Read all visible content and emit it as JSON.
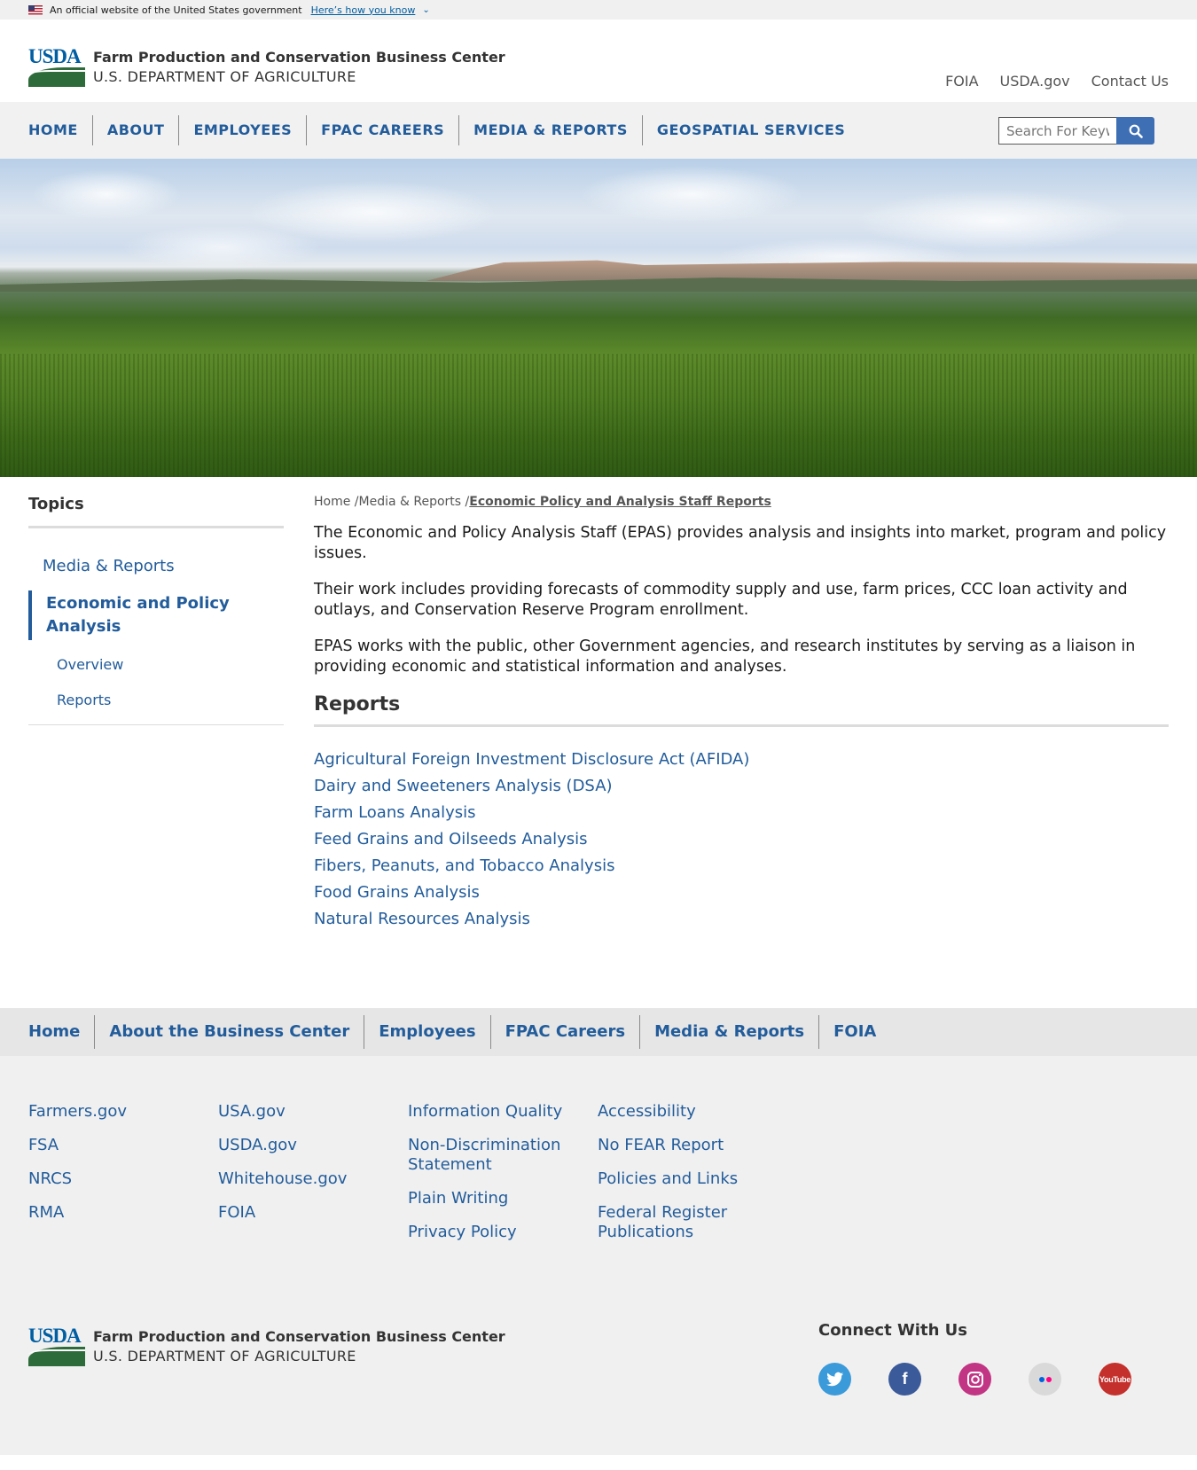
{
  "gov_banner": {
    "text": "An official website of the United States government",
    "link": "Here’s how you know"
  },
  "header": {
    "logo_text": "USDA",
    "agency_name": "Farm Production and Conservation Business Center",
    "department": "U.S. DEPARTMENT OF AGRICULTURE",
    "utility_links": [
      "FOIA",
      "USDA.gov",
      "Contact Us"
    ]
  },
  "main_nav": [
    "HOME",
    "ABOUT",
    "EMPLOYEES",
    "FPAC CAREERS",
    "MEDIA & REPORTS",
    "GEOSPATIAL SERVICES"
  ],
  "search": {
    "placeholder": "Search For Keyw"
  },
  "sidebar": {
    "title": "Topics",
    "link": "Media & Reports",
    "active": "Economic and Policy Analysis",
    "sub_items": [
      "Overview",
      "Reports"
    ]
  },
  "breadcrumb": {
    "home": "Home",
    "media": "Media & Reports",
    "current": "Economic Policy and Analysis Staff Reports"
  },
  "article": {
    "paragraphs": [
      "The Economic and Policy Analysis Staff (EPAS) provides analysis and insights into market, program and policy issues.",
      "Their work includes providing forecasts of commodity supply and use, farm prices, CCC loan activity and outlays, and Conservation Reserve Program enrollment.",
      "EPAS works with the public, other Government agencies, and research institutes by serving as a liaison in providing economic and statistical information and analyses."
    ],
    "reports_heading": "Reports",
    "reports": [
      "Agricultural Foreign Investment Disclosure Act (AFIDA)",
      "Dairy and Sweeteners Analysis (DSA)",
      "Farm Loans Analysis",
      "Feed Grains and Oilseeds Analysis",
      "Fibers, Peanuts, and Tobacco Analysis",
      "Food Grains Analysis",
      "Natural Resources Analysis"
    ]
  },
  "footer_nav": [
    "Home",
    "About the Business Center",
    "Employees",
    "FPAC Careers",
    "Media & Reports",
    "FOIA"
  ],
  "footer_columns": [
    [
      "Farmers.gov",
      "FSA",
      "NRCS",
      "RMA"
    ],
    [
      "USA.gov",
      "USDA.gov",
      "Whitehouse.gov",
      "FOIA"
    ],
    [
      "Information Quality",
      "Non-Discrimination Statement",
      "Plain Writing",
      "Privacy Policy"
    ],
    [
      "Accessibility",
      "No FEAR Report",
      "Policies and Links",
      "Federal Register Publications"
    ]
  ],
  "connect": {
    "title": "Connect With Us",
    "icons": [
      "twitter-icon",
      "facebook-icon",
      "instagram-icon",
      "flickr-icon",
      "youtube-icon"
    ]
  },
  "colors": {
    "link": "#225c9b",
    "usda_blue": "#005ea2",
    "usda_green": "#2e6b3a"
  }
}
